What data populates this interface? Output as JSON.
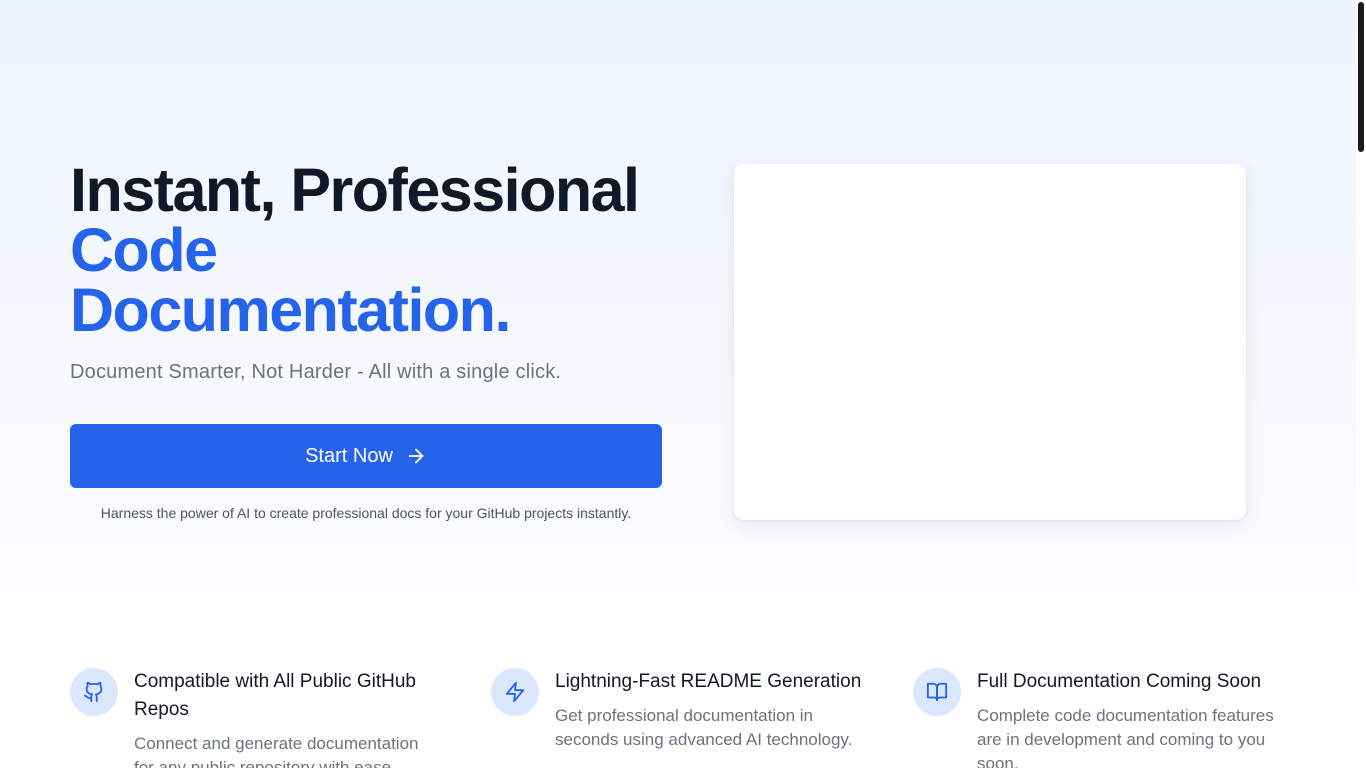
{
  "hero": {
    "headline_line1": "Instant, Professional",
    "headline_line2": "Code",
    "headline_line3": "Documentation.",
    "subtitle": "Document Smarter, Not Harder - All with a single click.",
    "cta_label": "Start Now",
    "cta_icon": "arrow-right-icon",
    "cta_note": "Harness the power of AI to create professional docs for your GitHub projects instantly."
  },
  "features": [
    {
      "icon": "github-icon",
      "title": "Compatible with All Public GitHub Repos",
      "description": "Connect and generate documentation for any public repository with ease."
    },
    {
      "icon": "lightning-icon",
      "title": "Lightning-Fast README Generation",
      "description": "Get professional documentation in seconds using advanced AI technology."
    },
    {
      "icon": "book-open-icon",
      "title": "Full Documentation Coming Soon",
      "description": "Complete code documentation features are in development and coming to you soon."
    }
  ],
  "colors": {
    "accent": "#2563eb",
    "heading": "#111827",
    "muted": "#6b7280",
    "icon_bg": "#dbe7fd",
    "hero_bg": "#eef4fe"
  }
}
